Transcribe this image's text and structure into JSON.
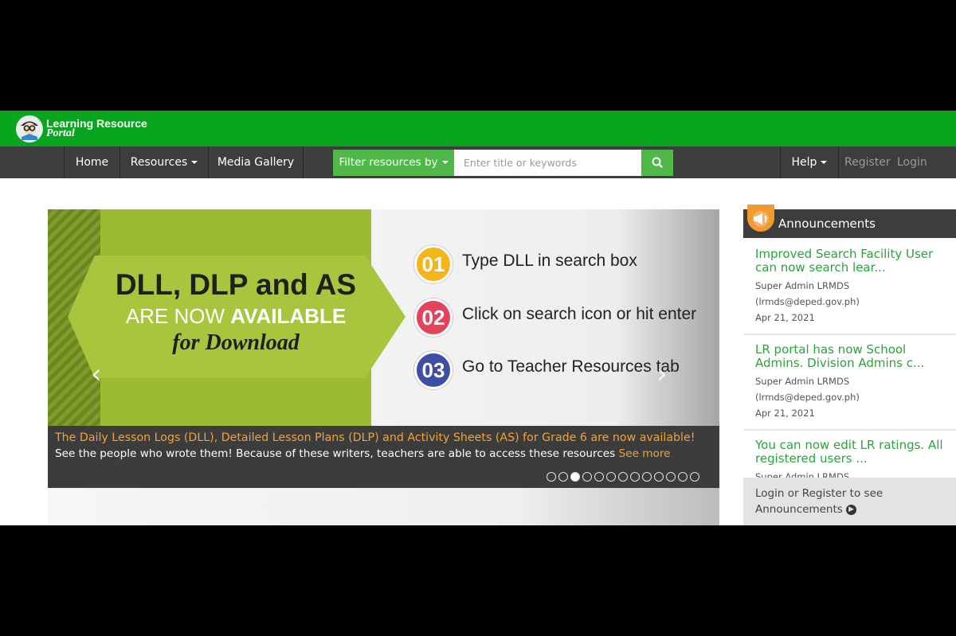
{
  "brand": {
    "name_line1": "Learning Resource",
    "name_line2": "Portal"
  },
  "nav": {
    "home": "Home",
    "resources": "Resources",
    "media_gallery": "Media Gallery",
    "filter_label": "Filter resources by",
    "search_placeholder": "Enter title or keywords",
    "help": "Help",
    "register": "Register",
    "login": "Login"
  },
  "slide": {
    "headline": "DLL, DLP and AS",
    "subline_prefix": "ARE NOW ",
    "subline_emphasis": "AVAILABLE",
    "subline_script": "for Download",
    "steps": [
      {
        "number": "01",
        "text": "Type DLL in search box",
        "color": "#f4b41a"
      },
      {
        "number": "02",
        "text": "Click on search icon or hit enter",
        "color": "#e2445c"
      },
      {
        "number": "03",
        "text": "Go to Teacher Resources tab",
        "color": "#3e4fa3"
      }
    ],
    "caption_title": "The Daily Lesson Logs (DLL), Detailed Lesson Plans (DLP) and Activity Sheets (AS) for Grade 6 are now available!",
    "caption_text": "See the people who wrote them! Because of these writers, teachers are able to access these resources ",
    "caption_link": "See more",
    "dots_total": 13,
    "dots_active_index": 2
  },
  "announcements": {
    "title": "Announcements",
    "items": [
      {
        "title": "Improved Search Facility User can now search lear...",
        "author": "Super Admin LRMDS",
        "email": "(lrmds@deped.gov.ph)",
        "date": "Apr 21, 2021"
      },
      {
        "title": "LR portal has now School Admins. Division Admins c...",
        "author": "Super Admin LRMDS",
        "email": "(lrmds@deped.gov.ph)",
        "date": "Apr 21, 2021"
      },
      {
        "title": "You can now edit LR ratings. All registered users ...",
        "author": "Super Admin LRMDS"
      }
    ],
    "footer_text": "Login or Register to see Announcements"
  },
  "colors": {
    "header_green": "#0aa51f",
    "nav_dark": "#3d3d3d",
    "accent_green": "#4fb848",
    "link_green": "#2aa33b",
    "accent_orange": "#f0a33a"
  }
}
